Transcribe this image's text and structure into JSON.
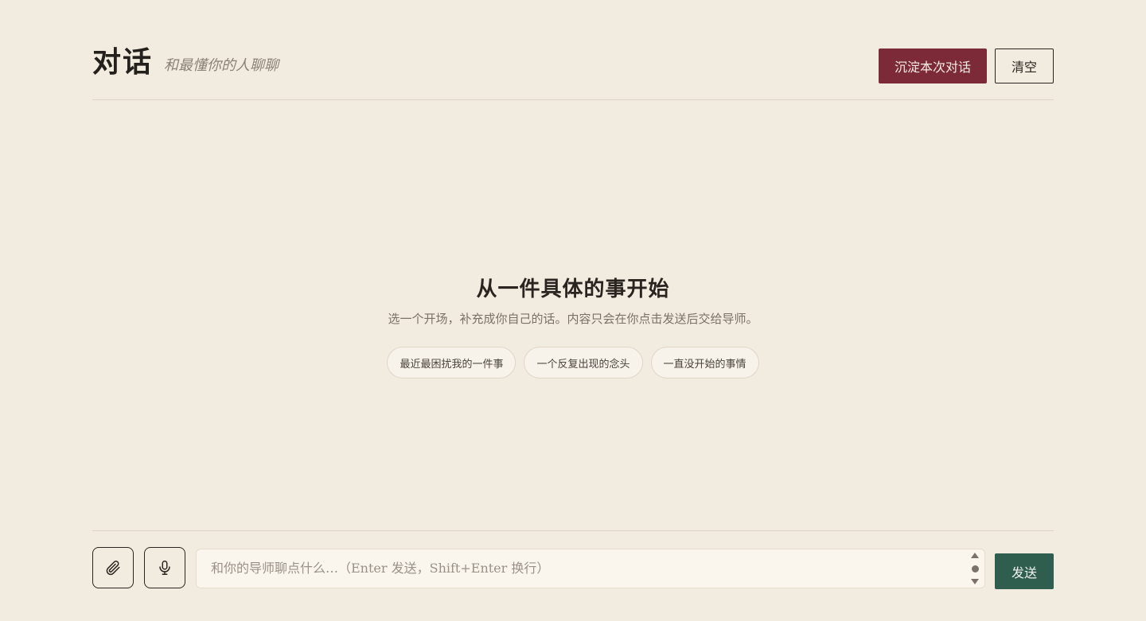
{
  "header": {
    "title": "对话",
    "subtitle": "和最懂你的人聊聊",
    "primary_button": "沉淀本次对话",
    "clear_button": "清空"
  },
  "empty_state": {
    "title": "从一件具体的事开始",
    "description": "选一个开场，补充成你自己的话。内容只会在你点击发送后交给导师。",
    "chips": [
      "最近最困扰我的一件事",
      "一个反复出现的念头",
      "一直没开始的事情"
    ]
  },
  "composer": {
    "attach_icon": "paperclip-icon",
    "mic_icon": "microphone-icon",
    "placeholder": "和你的导师聊点什么…（Enter 发送，Shift+Enter 换行）",
    "value": "",
    "send_button": "发送"
  },
  "colors": {
    "background": "#f2ebe0",
    "primary": "#7c2a38",
    "send": "#2f5d4e"
  }
}
